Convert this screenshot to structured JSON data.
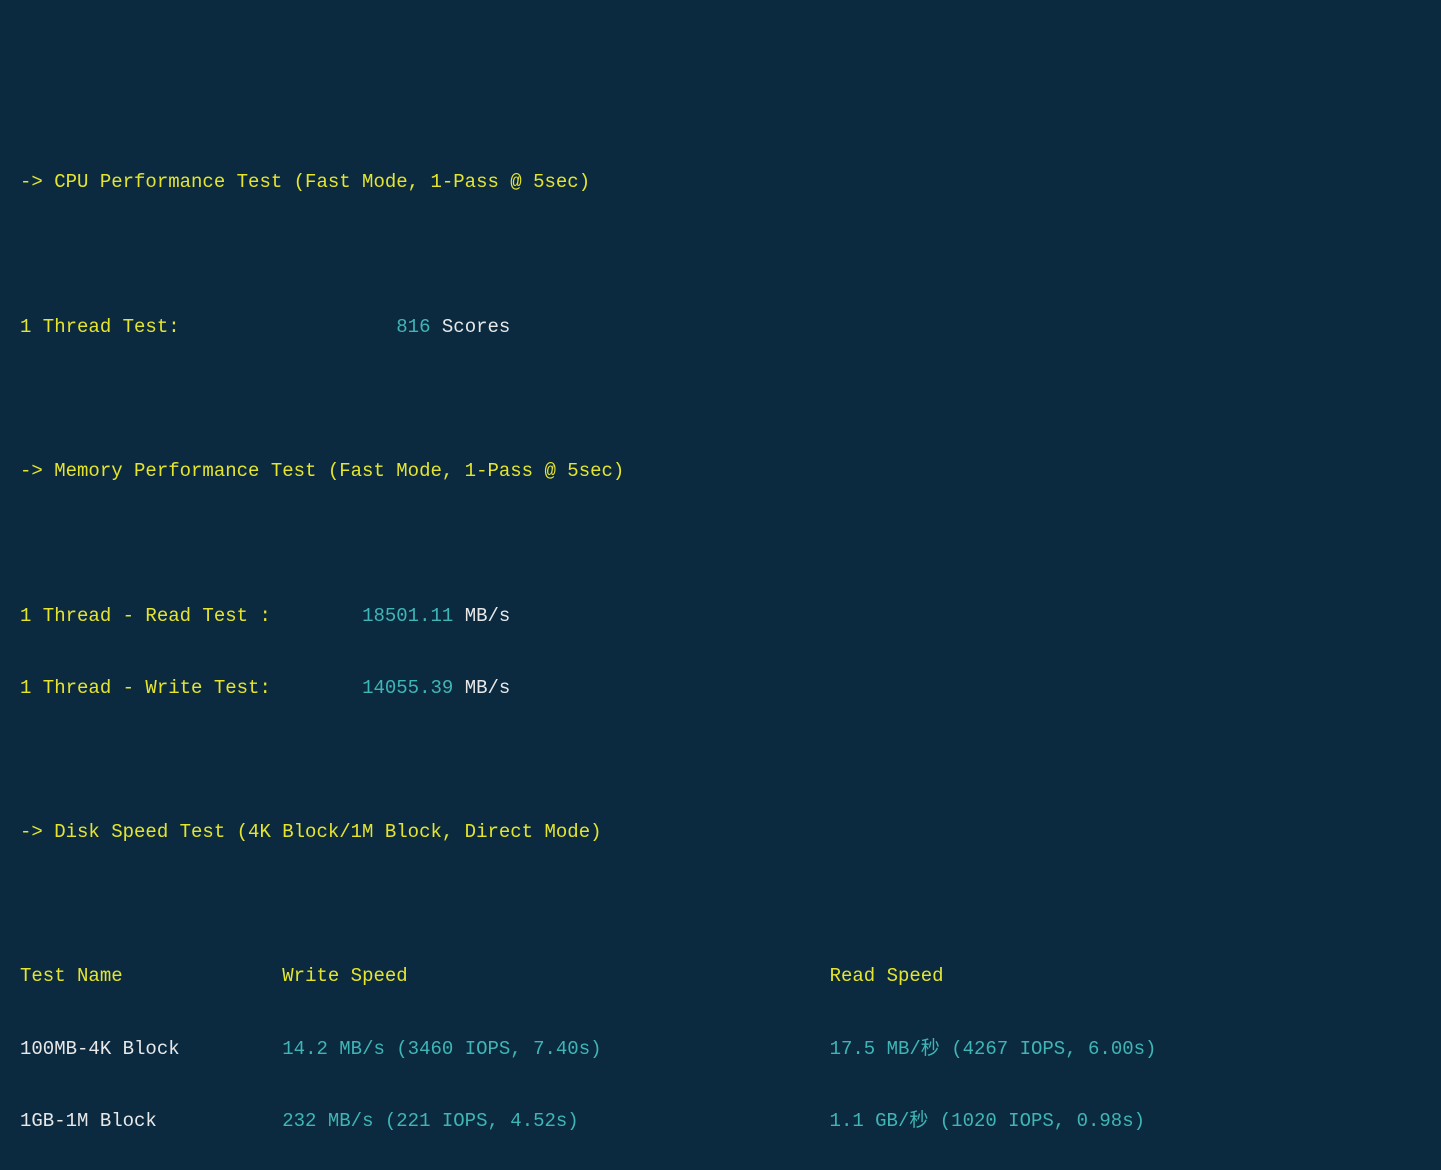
{
  "cpu": {
    "header": "-> CPU Performance Test (Fast Mode, 1-Pass @ 5sec)",
    "thread_label": "1 Thread Test:",
    "thread_value": "816",
    "thread_unit": "Scores"
  },
  "memory": {
    "header": "-> Memory Performance Test (Fast Mode, 1-Pass @ 5sec)",
    "read_label": "1 Thread - Read Test :",
    "read_value": "18501.11",
    "read_unit": "MB/s",
    "write_label": "1 Thread - Write Test:",
    "write_value": "14055.39",
    "write_unit": "MB/s"
  },
  "disk": {
    "header": "-> Disk Speed Test (4K Block/1M Block, Direct Mode)",
    "col_name": "Test Name",
    "col_write": "Write Speed",
    "col_read": "Read Speed",
    "rows": [
      {
        "name": "100MB-4K Block",
        "write": "14.2 MB/s (3460 IOPS, 7.40s)",
        "read": "17.5 MB/秒 (4267 IOPS, 6.00s)"
      },
      {
        "name": "1GB-1M Block",
        "write": "232 MB/s (221 IOPS, 4.52s)",
        "read": "1.1 GB/秒 (1020 IOPS, 0.98s)"
      }
    ]
  }
}
